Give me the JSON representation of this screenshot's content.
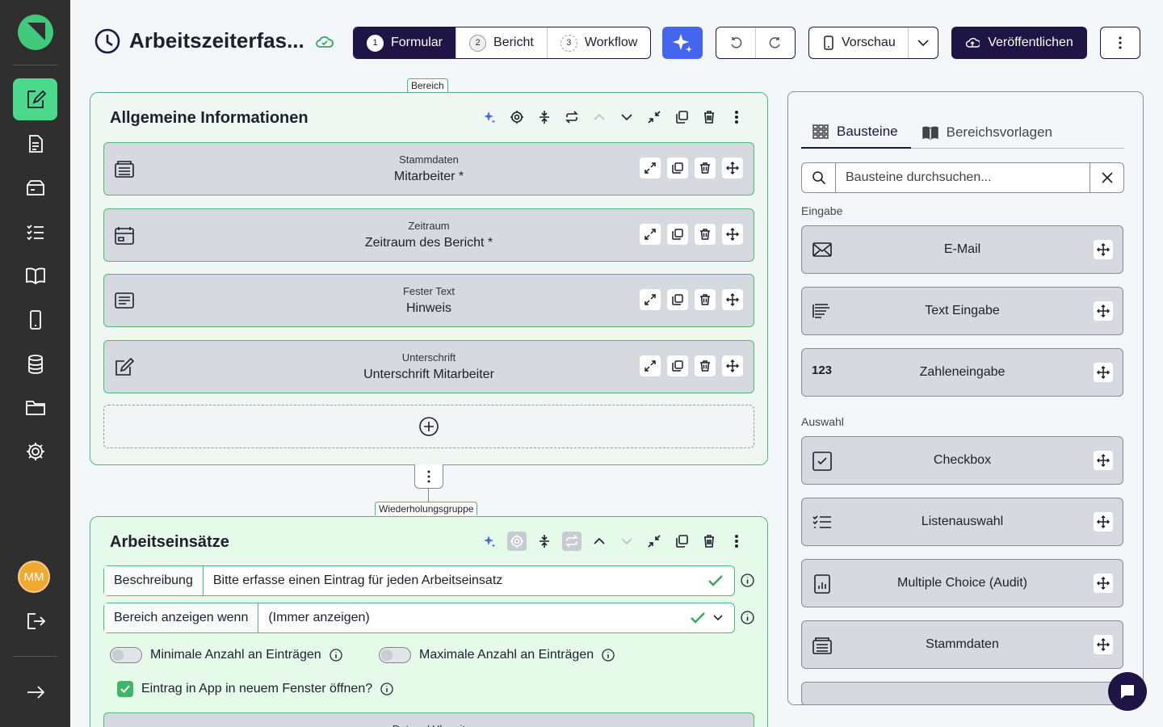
{
  "header": {
    "title": "Arbeitszeiterfas...",
    "steps": [
      {
        "num": "1",
        "label": "Formular"
      },
      {
        "num": "2",
        "label": "Bericht"
      },
      {
        "num": "3",
        "label": "Workflow"
      }
    ],
    "preview_label": "Vorschau",
    "publish_label": "Veröffentlichen"
  },
  "section1": {
    "tag": "Bereich",
    "title": "Allgemeine Informationen",
    "blocks": [
      {
        "type": "Stammdaten",
        "name": "Mitarbeiter *",
        "icon": "registry-icon"
      },
      {
        "type": "Zeitraum",
        "name": "Zeitraum des Bericht *",
        "icon": "calendar-icon"
      },
      {
        "type": "Fester Text",
        "name": "Hinweis",
        "icon": "text-icon"
      },
      {
        "type": "Unterschrift",
        "name": "Unterschrift Mitarbeiter",
        "icon": "signature-icon"
      }
    ]
  },
  "section2": {
    "tag": "Wiederholungsgruppe",
    "title": "Arbeitseinsätze",
    "description_label": "Beschreibung",
    "description_value": "Bitte erfasse einen Eintrag für jeden Arbeitseinsatz",
    "condition_label": "Bereich anzeigen wenn",
    "condition_value": "(Immer anzeigen)",
    "min_label": "Minimale Anzahl an Einträgen",
    "max_label": "Maximale Anzahl an Einträgen",
    "new_window_label": "Eintrag in App in neuem Fenster öffnen?",
    "next_block_type": "Datum / Uhrzeit"
  },
  "panel": {
    "tabs": [
      "Bausteine",
      "Bereichsvorlagen"
    ],
    "search_placeholder": "Bausteine durchsuchen...",
    "group_input": "Eingabe",
    "group_select": "Auswahl",
    "input_items": [
      {
        "label": "E-Mail",
        "icon": "mail-icon"
      },
      {
        "label": "Text Eingabe",
        "icon": "text-input-icon"
      },
      {
        "label": "Zahleneingabe",
        "icon": "number-icon",
        "glyph": "123"
      }
    ],
    "select_items": [
      {
        "label": "Checkbox",
        "icon": "checkbox-icon"
      },
      {
        "label": "Listenauswahl",
        "icon": "list-icon"
      },
      {
        "label": "Multiple Choice (Audit)",
        "icon": "chart-icon"
      },
      {
        "label": "Stammdaten",
        "icon": "registry-icon"
      }
    ]
  },
  "user": {
    "initials": "MM"
  },
  "colors": {
    "accent": "#1e1546",
    "green": "#4dd98b",
    "ai": "#4466ee"
  }
}
